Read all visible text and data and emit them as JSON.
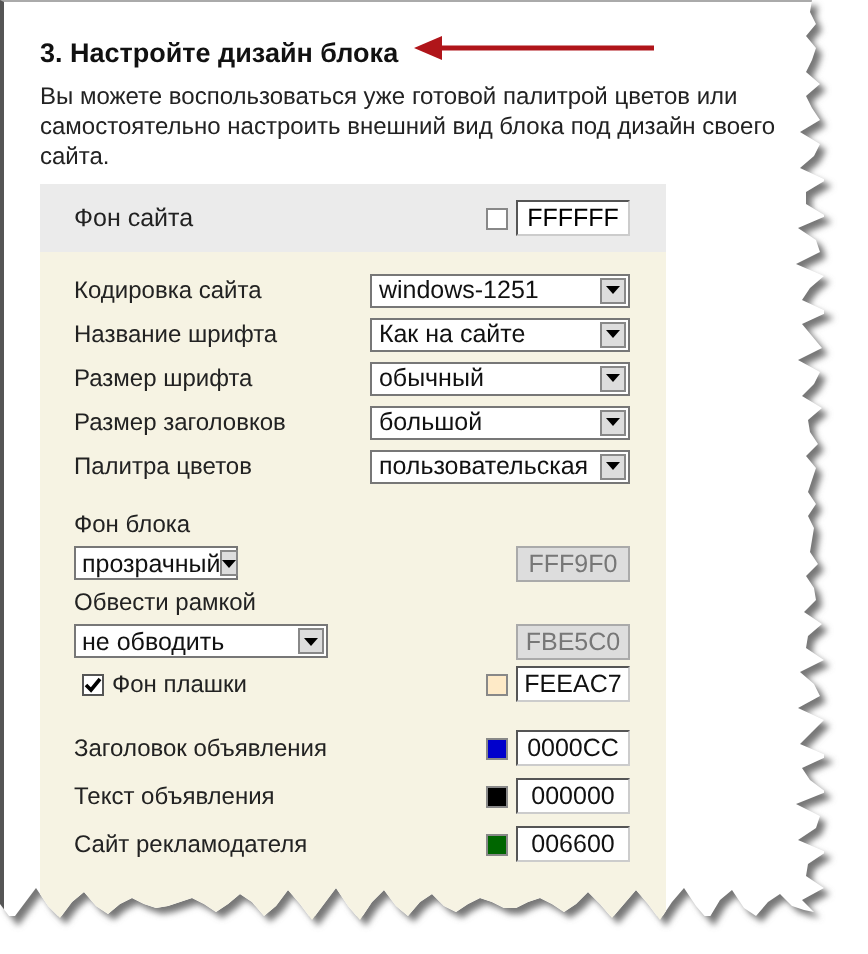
{
  "title": "3. Настройте дизайн блока",
  "description": "Вы можете воспользоваться уже готовой палитрой цветов или самостоятельно настроить внешний вид блока под дизайн своего сайта.",
  "site_background": {
    "label": "Фон сайта",
    "color": "#ffffff",
    "value": "FFFFFF"
  },
  "groups": [
    {
      "rows": [
        {
          "kind": "select",
          "label": "Кодировка сайта",
          "value": "windows-1251"
        },
        {
          "kind": "select",
          "label": "Название шрифта",
          "value": "Как на сайте"
        },
        {
          "kind": "select",
          "label": "Размер шрифта",
          "value": "обычный"
        },
        {
          "kind": "select",
          "label": "Размер заголовков",
          "value": "большой"
        },
        {
          "kind": "select",
          "label": "Палитра цветов",
          "value": "пользовательская"
        }
      ]
    },
    {
      "rows": [
        {
          "kind": "stacked",
          "label": "Фон блока",
          "value": "прозрачный",
          "field": "FFF9F0",
          "disabled": true
        },
        {
          "kind": "stacked",
          "label": "Обвести рамкой",
          "value": "не обводить",
          "field": "FBE5C0",
          "disabled": true
        },
        {
          "kind": "checkbox",
          "label": "Фон плашки",
          "checked": true,
          "color": "#feeac7",
          "field": "FEEAC7"
        }
      ]
    },
    {
      "rows": [
        {
          "kind": "color",
          "label": "Заголовок объявления",
          "color": "#0000cc",
          "field": "0000CC"
        },
        {
          "kind": "color",
          "label": "Текст объявления",
          "color": "#000000",
          "field": "000000"
        },
        {
          "kind": "color",
          "label": "Сайт рекламодателя",
          "color": "#006600",
          "field": "006600"
        }
      ]
    }
  ]
}
